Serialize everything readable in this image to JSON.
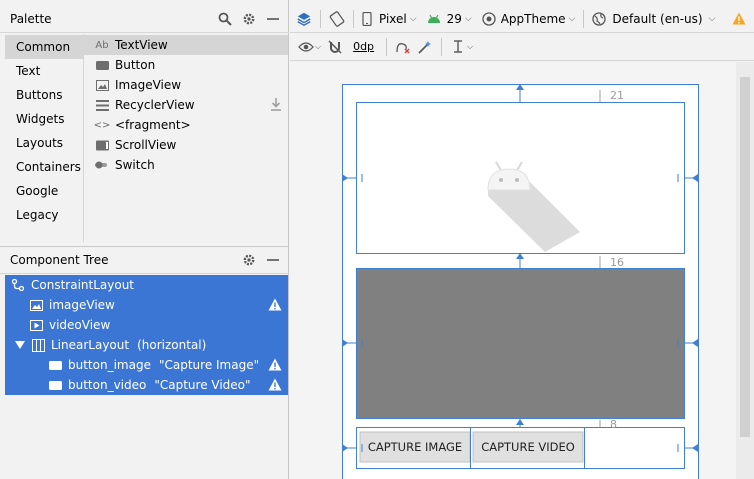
{
  "palette": {
    "title": "Palette",
    "categories": [
      "Common",
      "Text",
      "Buttons",
      "Widgets",
      "Layouts",
      "Containers",
      "Google",
      "Legacy"
    ],
    "selected_category": "Common",
    "items": [
      {
        "label": "TextView",
        "icon": "ab-text-icon",
        "icon_text": "Ab"
      },
      {
        "label": "Button",
        "icon": "button-icon",
        "icon_text": ""
      },
      {
        "label": "ImageView",
        "icon": "image-icon",
        "icon_text": ""
      },
      {
        "label": "RecyclerView",
        "icon": "list-icon",
        "icon_text": ""
      },
      {
        "label": "<fragment>",
        "icon": "code-icon",
        "icon_text": "<>"
      },
      {
        "label": "ScrollView",
        "icon": "scroll-icon",
        "icon_text": ""
      },
      {
        "label": "Switch",
        "icon": "switch-icon",
        "icon_text": ""
      }
    ]
  },
  "component_tree": {
    "title": "Component Tree",
    "nodes": [
      {
        "label": "ConstraintLayout",
        "extra": "",
        "warning": false
      },
      {
        "label": "imageView",
        "extra": "",
        "warning": true
      },
      {
        "label": "videoView",
        "extra": "",
        "warning": false
      },
      {
        "label": "LinearLayout",
        "extra": "(horizontal)",
        "warning": false
      },
      {
        "label": "button_image",
        "extra": "\"Capture Image\"",
        "warning": true
      },
      {
        "label": "button_video",
        "extra": "\"Capture Video\"",
        "warning": true
      }
    ]
  },
  "toolbar": {
    "device": "Pixel",
    "api_level": "29",
    "theme": "AppTheme",
    "locale": "Default (en-us)",
    "margin": "0dp"
  },
  "design": {
    "margin_top": "21",
    "margin_mid": "16",
    "margin_bottom": "8",
    "button_image_label": "CAPTURE IMAGE",
    "button_video_label": "CAPTURE VIDEO"
  },
  "colors": {
    "selection": "#3c76d4",
    "blueprint": "#3f7fd4",
    "video_fill": "#808080",
    "warning": "#f5a623"
  }
}
